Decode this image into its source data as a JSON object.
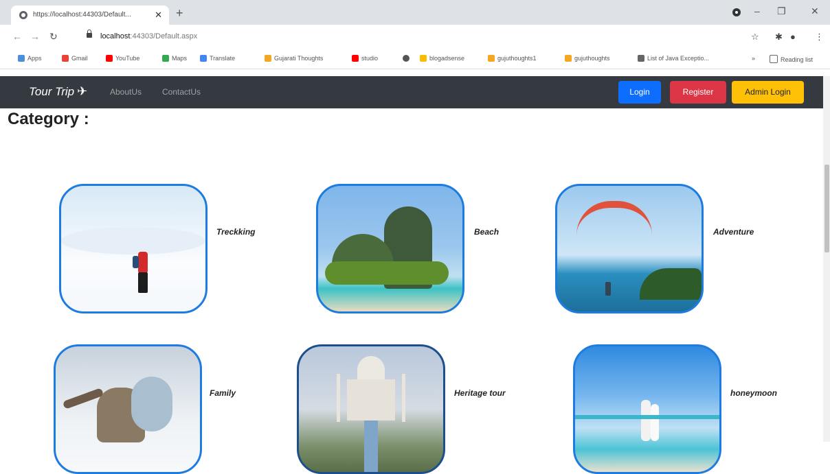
{
  "browser": {
    "tab_title": "https://localhost:44303/Default...",
    "url_host": "localhost",
    "url_rest": ":44303/Default.aspx",
    "bookmarks": [
      "Apps",
      "Gmail",
      "YouTube",
      "Maps",
      "Translate",
      "Gujarati Thoughts",
      "studio",
      "",
      "blogadsense",
      "gujuthoughts1",
      "gujuthoughts",
      "List of Java Exceptio...",
      "Reading list"
    ]
  },
  "site": {
    "brand": "Tour Trip",
    "nav": [
      "AboutUs",
      "ContactUs"
    ],
    "buttons": {
      "login": "Login",
      "register": "Register",
      "admin": "Admin Login"
    },
    "heading": "Category :",
    "categories": [
      {
        "label": "Treckking",
        "icon": "trekking-photo"
      },
      {
        "label": "Beach",
        "icon": "beach-photo"
      },
      {
        "label": "Adventure",
        "icon": "paraglide-photo"
      },
      {
        "label": "Family",
        "icon": "family-photo"
      },
      {
        "label": "Heritage tour",
        "icon": "tajmahal-photo"
      },
      {
        "label": "honeymoon",
        "icon": "couple-beach-photo"
      }
    ]
  },
  "colors": {
    "navbar": "#343a40",
    "primary": "#0d6efd",
    "danger": "#dc3545",
    "warning": "#ffc107",
    "card_border": "#1e7be0"
  }
}
